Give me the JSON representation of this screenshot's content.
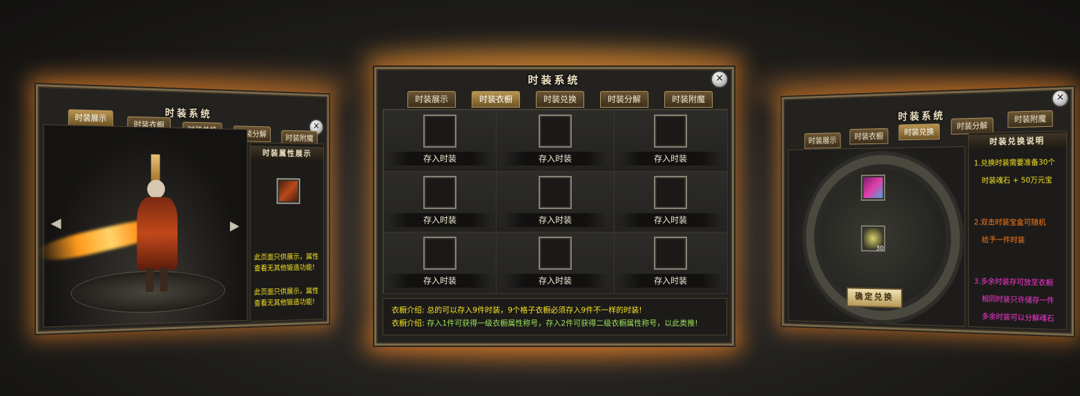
{
  "left_panel": {
    "title": "时装系统",
    "close": "✕",
    "tabs": [
      "时装展示",
      "时装衣橱",
      "时装兑换",
      "时装分解",
      "时装附魔"
    ],
    "active_tab": 0,
    "attr_title": "时装属性展示",
    "prev_arrow": "◀",
    "next_arrow": "▶",
    "notes": [
      "此页面只供展示，属性查看无其他锻造功能!",
      "此页面只供展示，属性查看无其他锻造功能!"
    ]
  },
  "center_panel": {
    "title": "时装系统",
    "close": "✕",
    "tabs": [
      "时装展示",
      "时装衣橱",
      "时装兑换",
      "时装分解",
      "时装附魔"
    ],
    "active_tab": 1,
    "slots": [
      "存入时装",
      "存入时装",
      "存入时装",
      "存入时装",
      "存入时装",
      "存入时装",
      "存入时装",
      "存入时装",
      "存入时装"
    ],
    "info": [
      {
        "label": "衣橱介绍:",
        "text": "总的可以存入9件时装，9个格子衣橱必须存入9件不一样的时装!"
      },
      {
        "label": "衣橱介绍:",
        "text": "存入1件可获得一级衣橱属性称号，存入2件可获得二级衣橱属性称号，以此类推!"
      }
    ]
  },
  "right_panel": {
    "title": "时装系统",
    "close": "✕",
    "tabs": [
      "时装展示",
      "时装衣橱",
      "时装兑换",
      "时装分解",
      "时装附魔"
    ],
    "active_tab": 2,
    "explain_title": "时装兑换说明",
    "item_count": "30",
    "confirm_button": "确定兑换",
    "notes": {
      "n1a": "1.兑换时装需要准备30个",
      "n1b": "时装魂石 + 50万元宝",
      "n2a": "2.双击时装宝盒可随机",
      "n2b": "给予一件时装",
      "n3a": "3.多余时装存可放至衣橱",
      "n3b": "相同时装只许储存一件",
      "n3c": "多余时装可以分解魂石"
    }
  },
  "colors": {
    "note_yellow": "#f7e324",
    "note_green": "#9ee25c",
    "note_orange": "#ff7a1e",
    "note_magenta": "#ff36d6",
    "glow": "#ff8c28"
  }
}
